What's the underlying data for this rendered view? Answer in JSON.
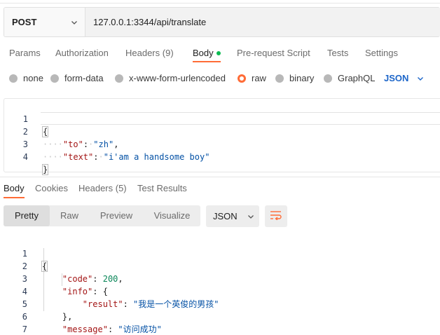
{
  "request": {
    "method": "POST",
    "url": "127.0.0.1:3344/api/translate"
  },
  "request_tabs": {
    "params": "Params",
    "authorization": "Authorization",
    "headers": "Headers",
    "headers_count": "(9)",
    "body": "Body",
    "pre_request_script": "Pre-request Script",
    "tests": "Tests",
    "settings": "Settings"
  },
  "body_types": {
    "none": "none",
    "form_data": "form-data",
    "urlencoded": "x-www-form-urlencoded",
    "raw": "raw",
    "binary": "binary",
    "graphql": "GraphQL",
    "selected": "raw",
    "format": "JSON"
  },
  "request_body": {
    "line_numbers": [
      "1",
      "2",
      "3",
      "4"
    ],
    "open_brace": "{",
    "close_brace": "}",
    "key1": "\"to\"",
    "val1": "\"zh\"",
    "key2": "\"text\"",
    "val2": "\"i'am a handsome boy\""
  },
  "response_tabs": {
    "body": "Body",
    "cookies": "Cookies",
    "headers": "Headers (5)",
    "test_results": "Test Results"
  },
  "response_view": {
    "pretty": "Pretty",
    "raw": "Raw",
    "preview": "Preview",
    "visualize": "Visualize",
    "format": "JSON"
  },
  "response_body": {
    "line_numbers": [
      "1",
      "2",
      "3",
      "4",
      "5",
      "6",
      "7"
    ],
    "open_brace": "{",
    "close_brace": "}",
    "code_key": "\"code\"",
    "code_val": "200",
    "info_key": "\"info\"",
    "result_key": "\"result\"",
    "result_val": "\"我是一个英俊的男孩\"",
    "message_key": "\"message\"",
    "message_val": "\"访问成功\""
  },
  "colors": {
    "accent": "#ff6c37",
    "active_dot": "#0cbb52",
    "json_select": "#1d66c9"
  }
}
